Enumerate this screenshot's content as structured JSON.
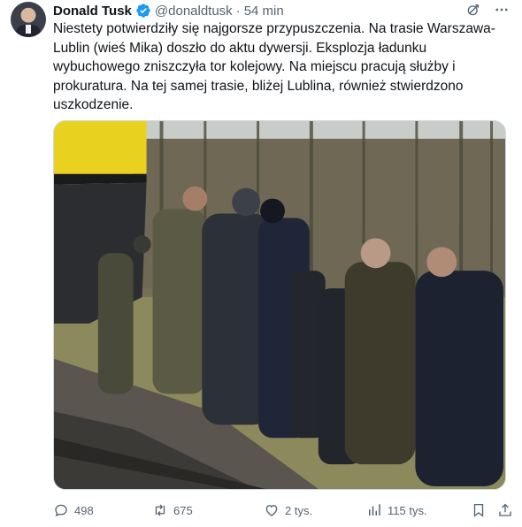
{
  "author": {
    "name": "Donald Tusk",
    "handle": "@donaldtusk",
    "separator": "·",
    "time": "54 min",
    "verified_color": "#1d9bf0"
  },
  "tweet": {
    "text": "Niestety potwierdziły się najgorsze przypuszczenia. Na trasie Warszawa-Lublin (wieś Mika) doszło do aktu dywersji. Eksplozja ładunku wybuchowego zniszczyła tor kolejowy. Na miejscu pracują służby i prokuratura. Na tej samej trasie, bliżej Lublina, również stwierdzono uszkodzenie."
  },
  "actions": {
    "replies": "498",
    "reposts": "675",
    "likes": "2 tys.",
    "views": "115 tys."
  },
  "icons": {
    "avatar": "avatar-photo",
    "verified": "verified-badge-icon",
    "grok": "grok-icon",
    "more": "more-icon",
    "reply": "reply-icon",
    "repost": "repost-icon",
    "like": "heart-icon",
    "views": "views-chart-icon",
    "bookmark": "bookmark-icon",
    "share": "share-icon"
  },
  "colors": {
    "text": "#0f1419",
    "secondary": "#536471",
    "accent": "#1d9bf0"
  }
}
